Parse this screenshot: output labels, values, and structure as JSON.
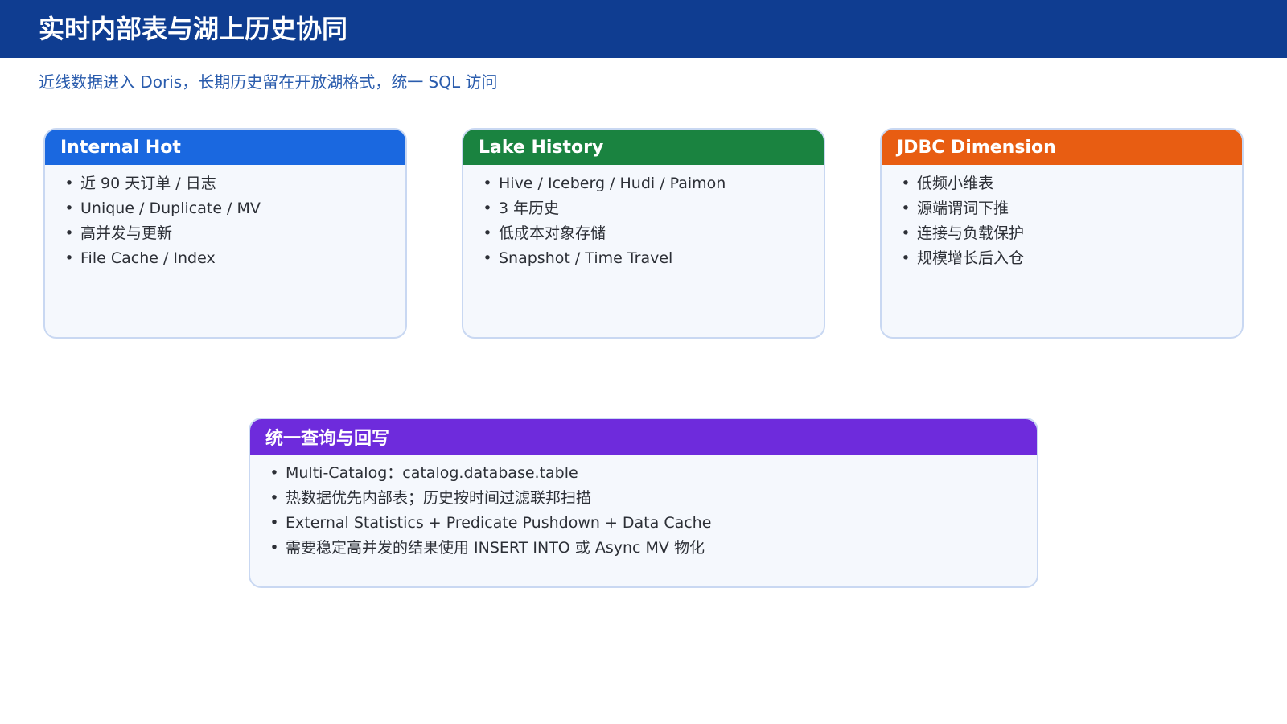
{
  "title": "实时内部表与湖上历史协同",
  "subtitle": "近线数据进入 Doris，长期历史留在开放湖格式，统一 SQL 访问",
  "colors": {
    "title_bar": "#0f3d91",
    "subtitle": "#2a5cad",
    "card_bg": "#f5f8fd",
    "card_border": "#c9d8f2",
    "internal_hot": "#1a68e0",
    "lake_history": "#1a8340",
    "jdbc_dimension": "#e85d12",
    "unified": "#6e2bdc"
  },
  "cards": [
    {
      "title": "Internal Hot",
      "color": "#1a68e0",
      "items": [
        "近 90 天订单 / 日志",
        "Unique / Duplicate / MV",
        "高并发与更新",
        "File Cache / Index"
      ]
    },
    {
      "title": "Lake History",
      "color": "#1a8340",
      "items": [
        "Hive / Iceberg / Hudi / Paimon",
        "3 年历史",
        "低成本对象存储",
        "Snapshot / Time Travel"
      ]
    },
    {
      "title": "JDBC Dimension",
      "color": "#e85d12",
      "items": [
        "低频小维表",
        "源端谓词下推",
        "连接与负载保护",
        "规模增长后入仓"
      ]
    }
  ],
  "unified": {
    "title": "统一查询与回写",
    "color": "#6e2bdc",
    "items": [
      "Multi-Catalog：catalog.database.table",
      "热数据优先内部表；历史按时间过滤联邦扫描",
      "External Statistics + Predicate Pushdown + Data Cache",
      "需要稳定高并发的结果使用 INSERT INTO 或 Async MV 物化"
    ]
  },
  "bullet": "•"
}
